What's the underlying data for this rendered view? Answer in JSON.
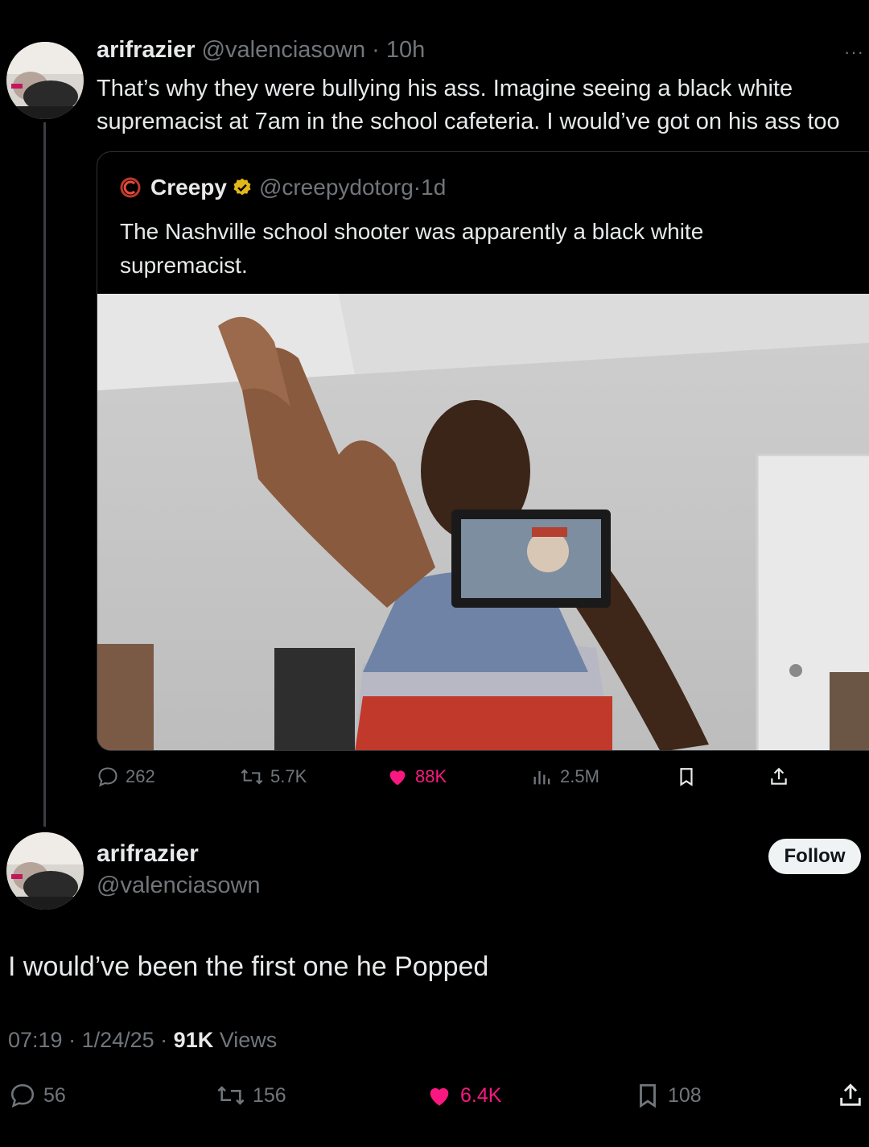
{
  "tweet1": {
    "name": "arifrazier",
    "handle": "@valenciasown",
    "time": "10h",
    "text_line1": "That’s why they were bullying his ass. Imagine seeing a black white",
    "text_line2": "supremacist at 7am in the school cafeteria. I would’ve got on his ass too",
    "more_icon": "more-dots-icon"
  },
  "quote": {
    "name": "Creepy",
    "handle": "@creepydotorg",
    "time": "1d",
    "text_line1": "The Nashville school shooter was apparently a black white",
    "text_line2": "supremacist.",
    "verified_color": "#e2b719",
    "logo_icon": "creepy-logo-icon"
  },
  "tweet1_actions": {
    "replies": "262",
    "reposts": "5.7K",
    "likes": "88K",
    "views": "2.5M"
  },
  "tweet2": {
    "name": "arifrazier",
    "handle": "@valenciasown",
    "follow_label": "Follow",
    "text": "I would’ve been the first one he Popped",
    "time": "07:19",
    "date": "1/24/25",
    "views_count": "91K",
    "views_label": "Views"
  },
  "tweet2_actions": {
    "replies": "56",
    "reposts": "156",
    "likes": "6.4K",
    "bookmarks": "108"
  },
  "colors": {
    "background": "#000000",
    "text": "#e7e9ea",
    "muted": "#71767b",
    "like": "#f91880"
  }
}
